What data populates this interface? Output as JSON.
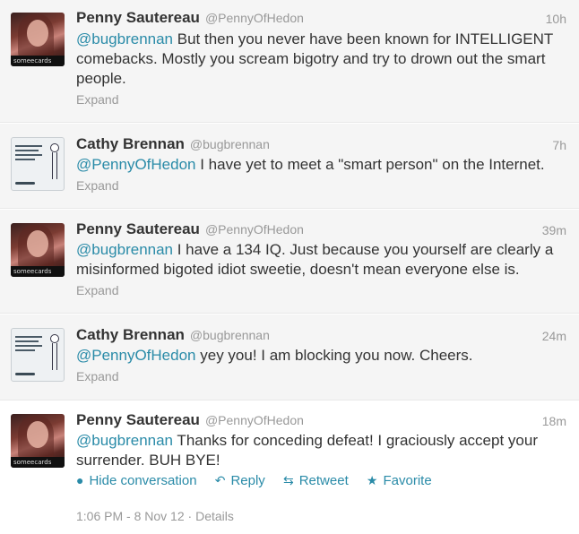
{
  "tweets": [
    {
      "name": "Penny Sautereau",
      "handle": "@PennyOfHedon",
      "time": "10h",
      "mention": "@bugbrennan",
      "text": " But then you never have been known for INTELLIGENT comebacks. Mostly you scream bigotry and try to drown out the smart people.",
      "expand": "Expand",
      "avatar": "penny-avatar"
    },
    {
      "name": "Cathy Brennan",
      "handle": "@bugbrennan",
      "time": "7h",
      "mention": "@PennyOfHedon",
      "text": " I have yet to meet a \"smart person\" on the Internet.",
      "expand": "Expand",
      "avatar": "cathy-avatar"
    },
    {
      "name": "Penny Sautereau",
      "handle": "@PennyOfHedon",
      "time": "39m",
      "mention": "@bugbrennan",
      "text": " I have a 134 IQ. Just because you yourself are clearly a misinformed bigoted idiot sweetie, doesn't mean everyone else is.",
      "expand": "Expand",
      "avatar": "penny-avatar"
    },
    {
      "name": "Cathy Brennan",
      "handle": "@bugbrennan",
      "time": "24m",
      "mention": "@PennyOfHedon",
      "text": " yey you! I am blocking you now. Cheers.",
      "expand": "Expand",
      "avatar": "cathy-avatar"
    },
    {
      "name": "Penny Sautereau",
      "handle": "@PennyOfHedon",
      "time": "18m",
      "mention": "@bugbrennan",
      "text": " Thanks for conceding defeat! I graciously accept your surrender. BUH BYE!",
      "avatar": "penny-avatar"
    }
  ],
  "actions": {
    "hide_conversation": "Hide conversation",
    "reply": "Reply",
    "retweet": "Retweet",
    "favorite": "Favorite"
  },
  "details": {
    "datetime": "1:06 PM - 8 Nov 12",
    "separator": "·",
    "link": "Details"
  },
  "avatar_badge_text": "someecards",
  "colors": {
    "mention": "#2a8ba8",
    "muted": "#999999",
    "text": "#333333",
    "expanded_bg": "#f5f5f5"
  }
}
